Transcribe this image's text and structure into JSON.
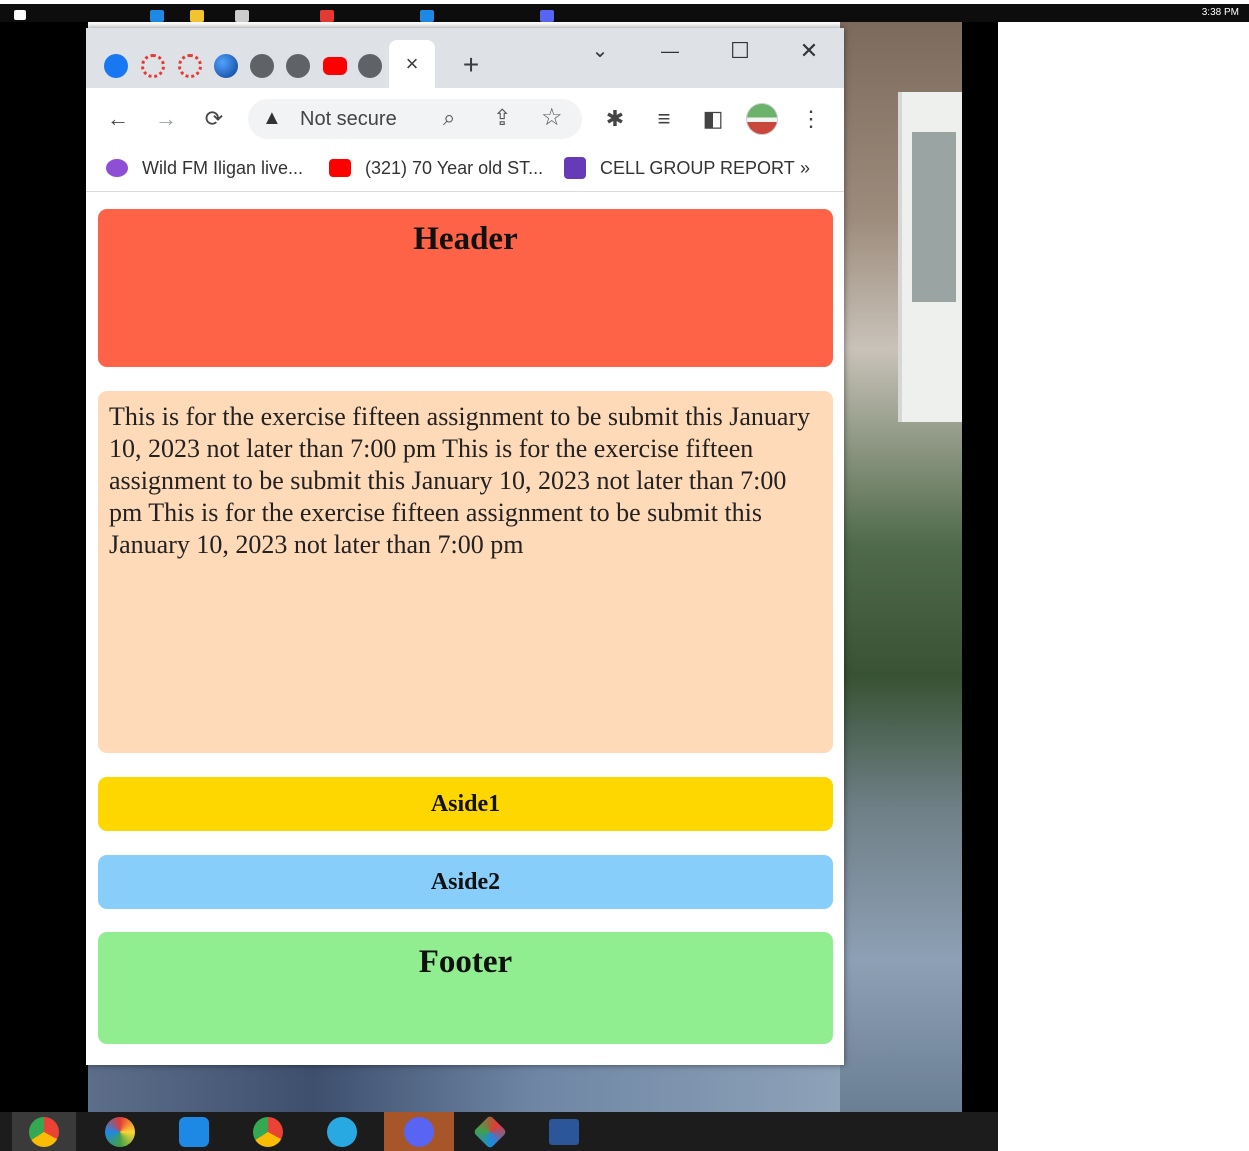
{
  "system": {
    "clock": "3:38 PM"
  },
  "browser": {
    "tab_close_glyph": "×",
    "new_tab_glyph": "+",
    "window_controls": {
      "tab_search": "⌄",
      "minimize": "—",
      "maximize": "☐",
      "close": "✕"
    },
    "toolbar": {
      "back": "←",
      "forward": "→",
      "reload": "⟳",
      "security_label": "Not secure",
      "more": "⋮"
    },
    "bookmarks": [
      {
        "label": "Wild FM Iligan live...",
        "color": "#8e4fd6"
      },
      {
        "label": "(321) 70 Year old ST...",
        "color": "#ff0000"
      },
      {
        "label": "CELL GROUP REPORT",
        "color": "#673ab7"
      }
    ],
    "bookmarks_overflow": "»"
  },
  "page": {
    "header": "Header",
    "main_text": "This is for the exercise fifteen assignment to be submit this January 10, 2023 not later than 7:00 pm This is for the exercise fifteen assignment to be submit this January 10, 2023 not later than 7:00 pm This is for the exercise fifteen assignment to be submit this January 10, 2023 not later than 7:00 pm",
    "aside1": "Aside1",
    "aside2": "Aside2",
    "footer": "Footer"
  },
  "colors": {
    "header": "#ff6347",
    "main": "#ffdab9",
    "aside1": "#ffd700",
    "aside2": "#87cefa",
    "footer": "#90ee90"
  }
}
